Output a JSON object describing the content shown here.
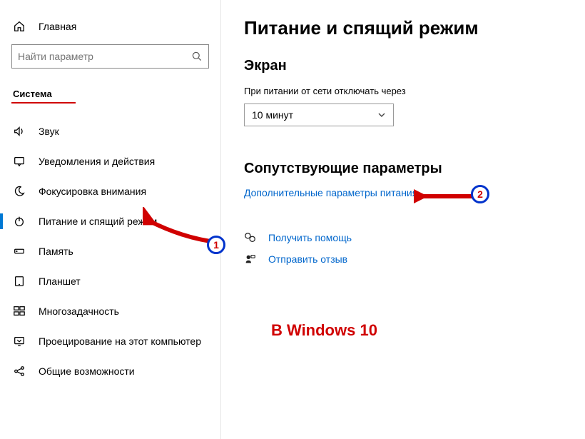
{
  "home_label": "Главная",
  "search_placeholder": "Найти параметр",
  "section_title": "Система",
  "nav": [
    {
      "label": "Звук"
    },
    {
      "label": "Уведомления и действия"
    },
    {
      "label": "Фокусировка внимания"
    },
    {
      "label": "Питание и спящий режим"
    },
    {
      "label": "Память"
    },
    {
      "label": "Планшет"
    },
    {
      "label": "Многозадачность"
    },
    {
      "label": "Проецирование на этот компьютер"
    },
    {
      "label": "Общие возможности"
    }
  ],
  "page_title": "Питание и спящий режим",
  "screen_title": "Экран",
  "screen_off_label": "При питании от сети отключать через",
  "screen_off_value": "10 минут",
  "related_title": "Сопутствующие параметры",
  "related_link": "Дополнительные параметры питания",
  "help_link": "Получить помощь",
  "feedback_link": "Отправить отзыв",
  "annotation_text": "В Windows 10",
  "badge1": "1",
  "badge2": "2"
}
